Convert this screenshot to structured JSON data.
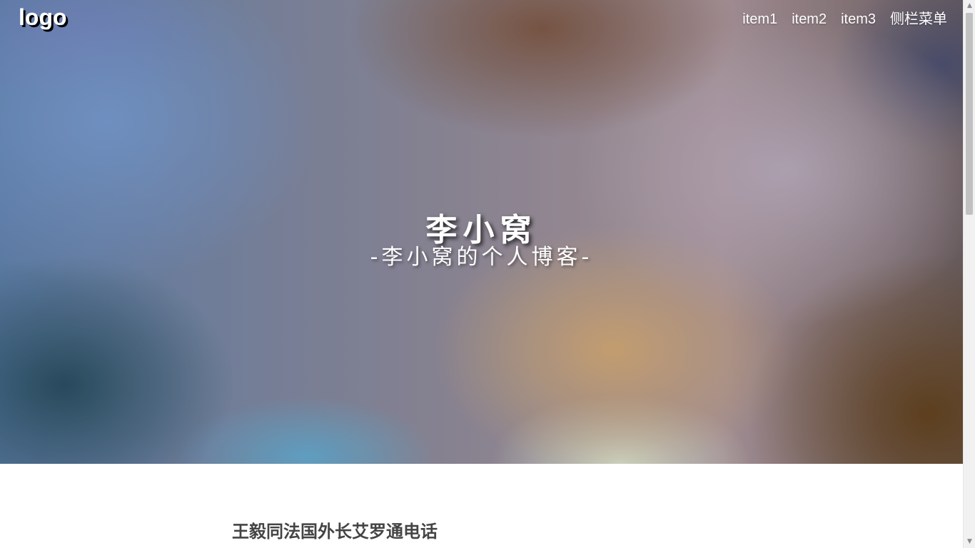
{
  "header": {
    "logo": "logo",
    "nav": [
      {
        "label": "item1"
      },
      {
        "label": "item2"
      },
      {
        "label": "item3"
      },
      {
        "label": "侧栏菜单"
      }
    ]
  },
  "hero": {
    "title": "李小窝",
    "subtitle": "-李小窝的个人博客-"
  },
  "articles": [
    {
      "title": "王毅同法国外长艾罗通电话"
    }
  ],
  "icons": {
    "scroll_up": "scroll-up-arrow-icon",
    "scroll_down": "scroll-down-arrow-icon"
  },
  "colors": {
    "hero_text": "#ffffff",
    "article_title": "#444444"
  }
}
